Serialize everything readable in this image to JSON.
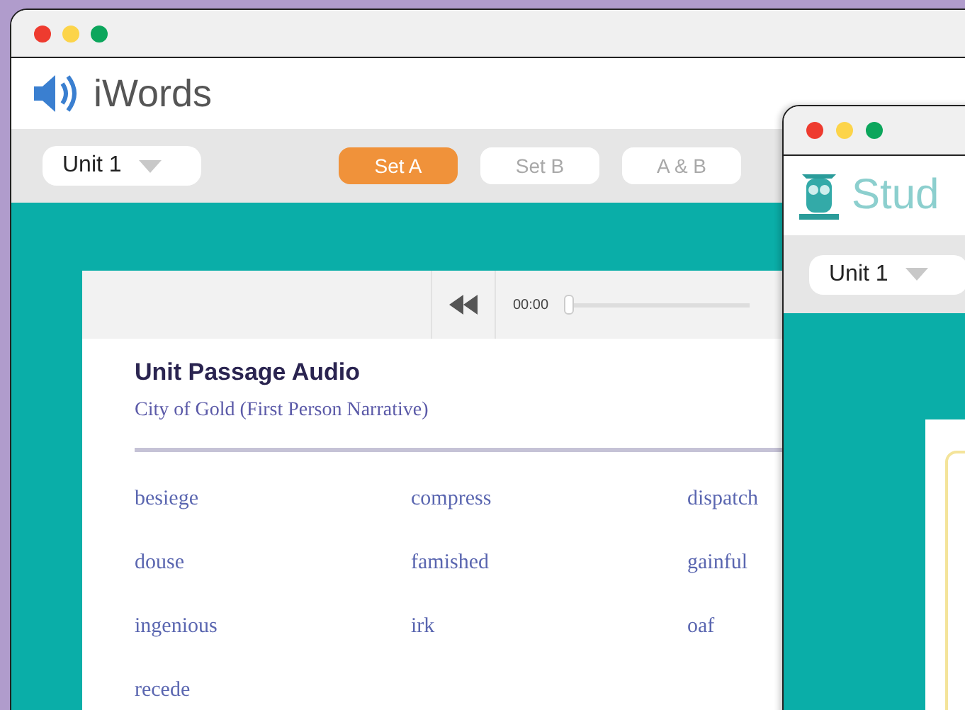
{
  "main_window": {
    "app_name": "iWords",
    "unit_dropdown": {
      "value": "Unit 1"
    },
    "tabs": [
      {
        "label": "Set A",
        "selected": true
      },
      {
        "label": "Set B",
        "selected": false
      },
      {
        "label": "A & B",
        "selected": false
      }
    ],
    "player": {
      "time": "00:00",
      "level": 0
    },
    "card": {
      "title": "Unit Passage Audio",
      "subtitle": "City of Gold (First Person Narrative)",
      "words": [
        "besiege",
        "compress",
        "dispatch",
        "douse",
        "famished",
        "gainful",
        "ingenious",
        "irk",
        "oaf",
        "recede"
      ]
    }
  },
  "second_window": {
    "app_name": "Stud",
    "unit_dropdown": {
      "value": "Unit 1"
    }
  }
}
